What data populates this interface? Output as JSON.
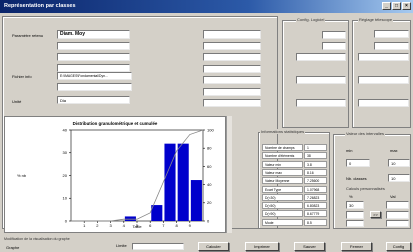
{
  "window": {
    "title": "Représentation par classes"
  },
  "top_labels": {
    "config_logiciel": "Config. Logiciel",
    "reglage_telescope": "Réglage télescope"
  },
  "fields": {
    "parametre_label": "Paramètre retenu",
    "parametre_value": "Diam. Moy",
    "fichier_label": "Fichier info",
    "fichier_value": "E:\\IMAGES\\Fondamental\\Dyn...",
    "unite_label": "Unité",
    "unite_value": "Dia"
  },
  "stats": {
    "title": "Informations statistiques",
    "rows": [
      {
        "label": "Nombre de champs",
        "value": "1"
      },
      {
        "label": "Nombre d'éléments",
        "value": "38"
      },
      {
        "label": "Valeur min",
        "value": "3.8"
      },
      {
        "label": "Valeur max",
        "value": "8.16"
      },
      {
        "label": "Valeur Moyenne",
        "value": "7.25600"
      },
      {
        "label": "Ecart Type",
        "value": "1.07968"
      },
      {
        "label": "D(<30)",
        "value": "7.26823"
      },
      {
        "label": "D(<50)",
        "value": "6.80823"
      },
      {
        "label": "D(<90)",
        "value": "8.67779"
      },
      {
        "label": "Mode",
        "value": "8.5"
      }
    ]
  },
  "intervals": {
    "title": "Valeur des intervalles",
    "min_label": "min",
    "max_label": "max",
    "min_value": "0",
    "max_value": "10",
    "classes_label": "Nb. classes",
    "classes_value": "10",
    "percentile_title": "Calculs personnalisés",
    "pct_col": "%",
    "val_col": "Val",
    "pct_value": "30",
    "val_value": "",
    "arrow_label": ">>"
  },
  "bottom": {
    "modif_label": "Modification de la visualisation du graphe",
    "graphe_label": "Graphe",
    "limite_label": "Limite"
  },
  "buttons": {
    "calculer": "Calculer",
    "imprimer": "Imprimer",
    "sauver": "Sauver",
    "fermer": "Fermer",
    "config": "Config"
  },
  "chart_data": {
    "type": "bar",
    "title": "Distribution granulométrique et cumulée",
    "ylabel": "% nb",
    "xlabel": "Taille",
    "ylim": [
      0,
      40
    ],
    "y2lim": [
      0,
      100
    ],
    "categories": [
      "1",
      "2",
      "3",
      "4",
      "5",
      "6",
      "7",
      "8",
      "9"
    ],
    "series": [
      {
        "values": [
          0,
          0,
          0,
          0,
          2,
          0,
          7,
          34,
          34,
          18
        ]
      },
      {
        "values": [
          0,
          0,
          0,
          0,
          2,
          2,
          9,
          43,
          77,
          95,
          100
        ]
      }
    ],
    "y_ticks": [
      "0",
      "10",
      "20",
      "30",
      "40"
    ],
    "y2_ticks": [
      "0",
      "20",
      "40",
      "60",
      "80",
      "100"
    ]
  }
}
